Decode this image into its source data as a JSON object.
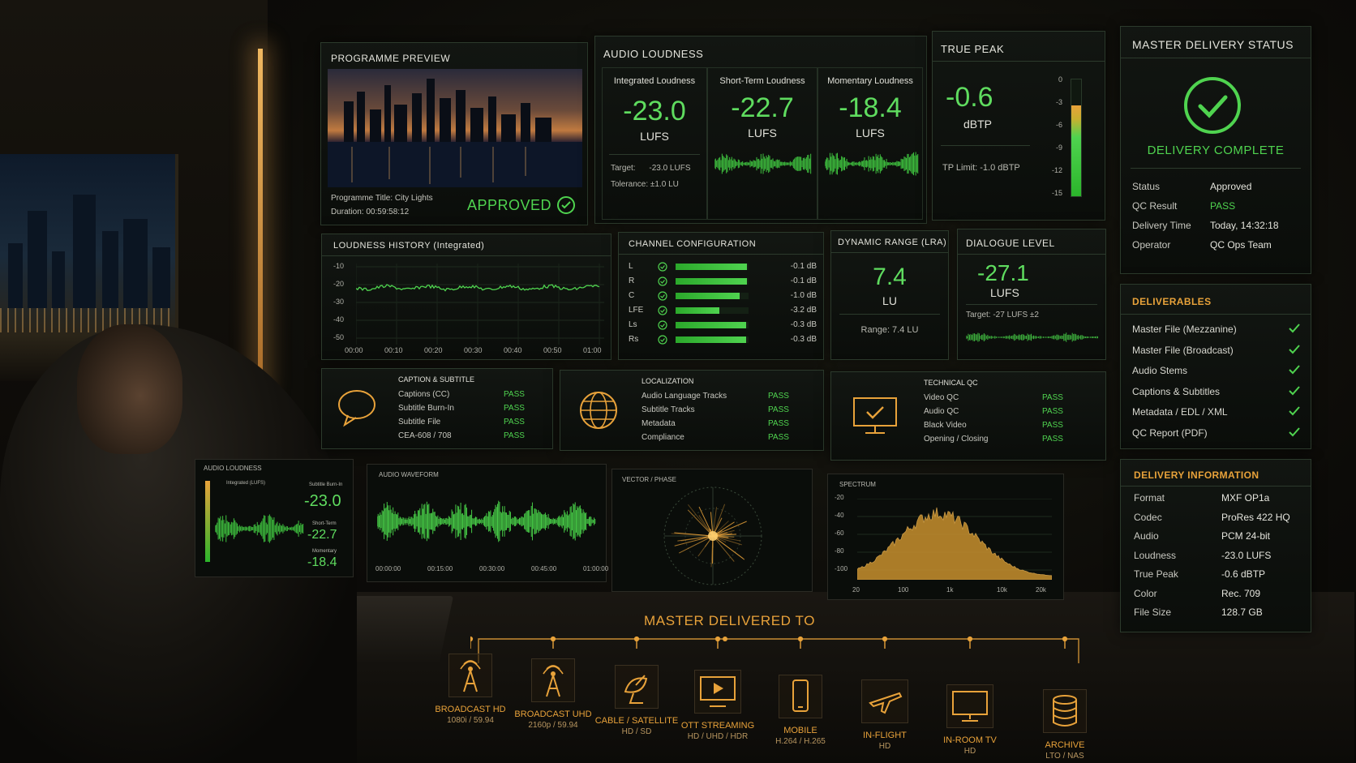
{
  "preview": {
    "title": "PROGRAMME PREVIEW",
    "programme_title_label": "Programme Title:",
    "programme_title": "City Lights",
    "duration_label": "Duration:",
    "duration": "00:59:58:12",
    "status": "APPROVED"
  },
  "loudness": {
    "title": "AUDIO LOUDNESS",
    "integrated": {
      "label": "Integrated Loudness",
      "value": "-23.0",
      "unit": "LUFS",
      "target_label": "Target:",
      "target": "-23.0 LUFS",
      "tolerance_label": "Tolerance:",
      "tolerance": "±1.0 LU"
    },
    "short_term": {
      "label": "Short-Term Loudness",
      "value": "-22.7",
      "unit": "LUFS"
    },
    "momentary": {
      "label": "Momentary Loudness",
      "value": "-18.4",
      "unit": "LUFS"
    }
  },
  "true_peak": {
    "title": "TRUE PEAK",
    "value": "-0.6",
    "unit": "dBTP",
    "limit": "TP Limit: -1.0 dBTP",
    "scale": [
      "0",
      "-3",
      "-6",
      "-9",
      "-12",
      "-15"
    ],
    "meter_level": 0.78
  },
  "master_status": {
    "title": "MASTER DELIVERY STATUS",
    "headline": "DELIVERY COMPLETE",
    "rows": [
      {
        "label": "Status",
        "value": "Approved"
      },
      {
        "label": "QC Result",
        "value": "PASS"
      },
      {
        "label": "Delivery Time",
        "value": "Today, 14:32:18"
      },
      {
        "label": "Operator",
        "value": "QC Ops Team"
      }
    ]
  },
  "history": {
    "title": "LOUDNESS HISTORY (Integrated)",
    "y_ticks": [
      "-10",
      "-20",
      "-30",
      "-40",
      "-50"
    ],
    "x_ticks": [
      "00:00",
      "00:10",
      "00:20",
      "00:30",
      "00:40",
      "00:50",
      "01:00"
    ]
  },
  "channels": {
    "title": "CHANNEL CONFIGURATION",
    "items": [
      {
        "name": "L",
        "db": "-0.1 dB",
        "level": 0.98
      },
      {
        "name": "R",
        "db": "-0.1 dB",
        "level": 0.98
      },
      {
        "name": "C",
        "db": "-1.0 dB",
        "level": 0.88
      },
      {
        "name": "LFE",
        "db": "-3.2 dB",
        "level": 0.6
      },
      {
        "name": "Ls",
        "db": "-0.3 dB",
        "level": 0.97
      },
      {
        "name": "Rs",
        "db": "-0.3 dB",
        "level": 0.97
      }
    ]
  },
  "dynamic": {
    "title": "DYNAMIC RANGE (LRA)",
    "value": "7.4",
    "unit": "LU",
    "range": "Range: 7.4 LU"
  },
  "dialogue": {
    "title": "DIALOGUE LEVEL",
    "value": "-27.1",
    "unit": "LUFS",
    "target": "Target:  -27 LUFS ±2"
  },
  "deliverables": {
    "title": "DELIVERABLES",
    "items": [
      "Master File (Mezzanine)",
      "Master File (Broadcast)",
      "Audio Stems",
      "Captions & Subtitles",
      "Metadata / EDL / XML",
      "QC Report (PDF)"
    ]
  },
  "caption": {
    "title": "CAPTION & SUBTITLE",
    "rows": [
      {
        "label": "Captions (CC)",
        "value": "PASS"
      },
      {
        "label": "Subtitle Burn-In",
        "value": "PASS"
      },
      {
        "label": "Subtitle File",
        "value": "PASS"
      },
      {
        "label": "CEA-608 / 708",
        "value": "PASS"
      }
    ]
  },
  "localization": {
    "title": "LOCALIZATION",
    "rows": [
      {
        "label": "Audio Language Tracks",
        "value": "PASS"
      },
      {
        "label": "Subtitle Tracks",
        "value": "PASS"
      },
      {
        "label": "Metadata",
        "value": "PASS"
      },
      {
        "label": "Compliance",
        "value": "PASS"
      }
    ]
  },
  "technical": {
    "title": "TECHNICAL QC",
    "rows": [
      {
        "label": "Video QC",
        "value": "PASS"
      },
      {
        "label": "Audio QC",
        "value": "PASS"
      },
      {
        "label": "Black Video",
        "value": "PASS"
      },
      {
        "label": "Opening / Closing",
        "value": "PASS"
      }
    ]
  },
  "delivery_info": {
    "title": "DELIVERY INFORMATION",
    "rows": [
      {
        "label": "Format",
        "value": "MXF OP1a"
      },
      {
        "label": "Codec",
        "value": "ProRes 422 HQ"
      },
      {
        "label": "Audio",
        "value": "PCM 24-bit"
      },
      {
        "label": "Loudness",
        "value": "-23.0  LUFS"
      },
      {
        "label": "True Peak",
        "value": "-0.6 dBTP"
      },
      {
        "label": "Color",
        "value": "Rec. 709"
      },
      {
        "label": "File Size",
        "value": "128.7 GB"
      }
    ]
  },
  "lower_screens": {
    "mini_loudness": {
      "title": "AUDIO LOUDNESS",
      "int_label": "Integrated (LUFS)",
      "st_label": "Subtitle Burn-In",
      "val1": "-23.0",
      "short_label": "Short-Term",
      "val2": "-22.7",
      "mom_label": "Momentary",
      "val3": "-18.4"
    },
    "waveform": {
      "title": "AUDIO WAVEFORM",
      "x_ticks": [
        "00:00:00",
        "00:15:00",
        "00:30:00",
        "00:45:00",
        "01:00:00"
      ]
    },
    "vector": {
      "title": "VECTOR / PHASE"
    },
    "spectrum": {
      "title": "SPECTRUM",
      "y_ticks": [
        "-20",
        "-40",
        "-60",
        "-80",
        "-100"
      ],
      "x_ticks": [
        "20",
        "100",
        "1k",
        "10k",
        "20k"
      ]
    }
  },
  "delivered_to": {
    "title": "MASTER DELIVERED TO",
    "destinations": [
      {
        "name": "BROADCAST HD",
        "spec": "1080i / 59.94",
        "icon": "broadcast-tower-icon"
      },
      {
        "name": "BROADCAST UHD",
        "spec": "2160p / 59.94",
        "icon": "broadcast-tower-icon"
      },
      {
        "name": "CABLE / SATELLITE",
        "spec": "HD / SD",
        "icon": "satellite-dish-icon"
      },
      {
        "name": "OTT STREAMING",
        "spec": "HD / UHD / HDR",
        "icon": "streaming-play-icon"
      },
      {
        "name": "MOBILE",
        "spec": "H.264 / H.265",
        "icon": "mobile-phone-icon"
      },
      {
        "name": "IN-FLIGHT",
        "spec": "HD",
        "icon": "airplane-icon"
      },
      {
        "name": "IN-ROOM TV",
        "spec": "HD",
        "icon": "tv-monitor-icon"
      },
      {
        "name": "ARCHIVE",
        "spec": "LTO / NAS",
        "icon": "database-icon"
      }
    ]
  },
  "colors": {
    "accent_green": "#4fd34f",
    "accent_orange": "#e8a23a",
    "panel_border": "#2c3a2c"
  }
}
